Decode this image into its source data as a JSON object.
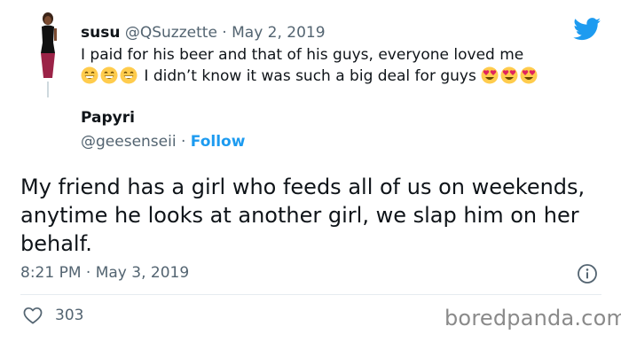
{
  "reply_tweet": {
    "display_name": "susu",
    "handle": "@QSuzzette",
    "separator": " · ",
    "date": "May 2, 2019",
    "text_line1": "I paid for his beer and that of his guys, everyone loved me",
    "text_line2": "I didn’t know it was such a big deal for guys"
  },
  "main_tweet": {
    "display_name": "Papyri",
    "handle": "@geesenseii",
    "separator": " · ",
    "follow_label": "Follow",
    "text": "My friend has a girl who feeds all of us on weekends, anytime he looks at another girl, we slap him on her behalf.",
    "timestamp": "8:21 PM · May 3, 2019",
    "likes": "303"
  },
  "watermark": "boredpanda.com",
  "colors": {
    "brand_blue": "#1d9bf0",
    "text_primary": "#0f1419",
    "text_secondary": "#536471",
    "divider": "#e6ecf0"
  },
  "icons": [
    "twitter-bird-icon",
    "grinning-emoji-icon",
    "heart-eyes-emoji-icon",
    "info-icon",
    "heart-icon"
  ]
}
